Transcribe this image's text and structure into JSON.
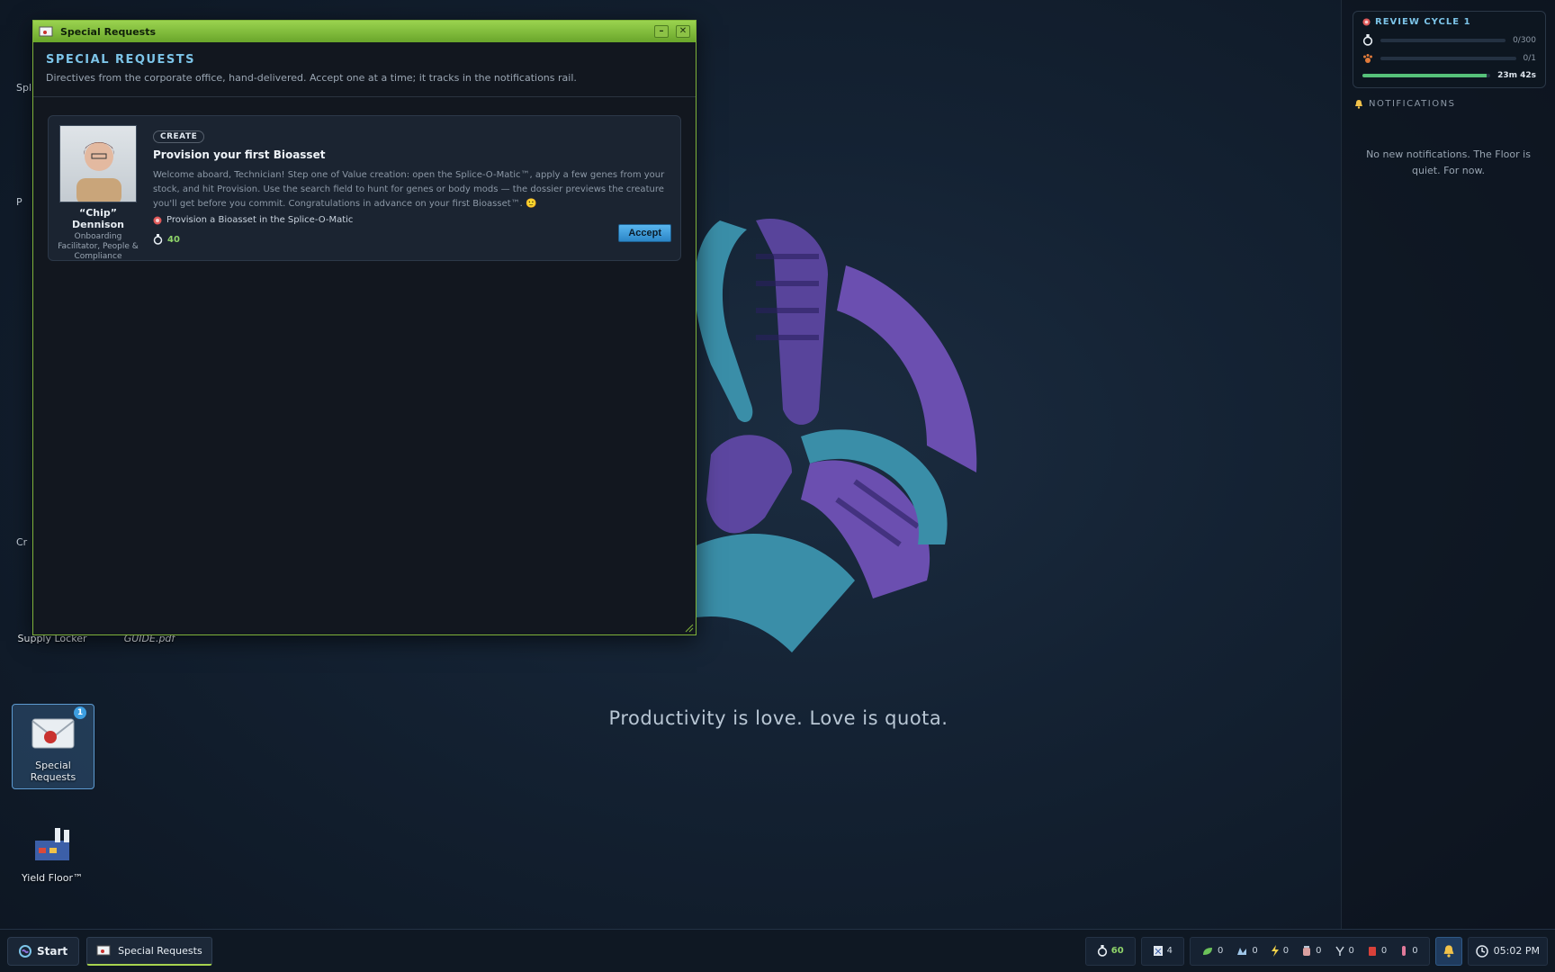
{
  "window": {
    "title": "Special Requests",
    "heading": "SPECIAL REQUESTS",
    "subtitle": "Directives from the corporate office, hand-delivered. Accept one at a time; it tracks in the notifications rail."
  },
  "request_card": {
    "badge": "CREATE",
    "title": "Provision your first Bioasset",
    "description": "Welcome aboard, Technician! Step one of Value creation: open the Splice-O-Matic™, apply a few genes from your stock, and hit Provision. Use the search field to hunt for genes or body mods — the dossier previews the creature you'll get before you commit. Congratulations in advance on your first Bioasset™. 🙂",
    "objective": "Provision a Bioasset in the Splice-O-Matic",
    "reward": "40",
    "accept_label": "Accept",
    "person_name": "“Chip” Dennison",
    "person_role": "Onboarding Facilitator, People & Compliance"
  },
  "desktop": {
    "partial_labels": [
      "Spli",
      "P",
      "Cr"
    ],
    "icons": [
      {
        "label": "Supply Locker"
      },
      {
        "label": "GUIDE.pdf"
      },
      {
        "label": "Special Requests",
        "badge": "1"
      },
      {
        "label": "Yield Floor™"
      }
    ],
    "slogan": "Productivity is love. Love is quota."
  },
  "review_cycle": {
    "title": "REVIEW CYCLE 1",
    "rows": [
      {
        "icon": "flask-icon",
        "value": "0/300",
        "progress": 0
      },
      {
        "icon": "paw-icon",
        "value": "0/1",
        "progress": 0
      }
    ],
    "timer": "23m 42s",
    "timer_progress": 0.97
  },
  "notifications": {
    "heading": "NOTIFICATIONS",
    "empty_text": "No new notifications. The Floor is quiet. For now."
  },
  "taskbar": {
    "start_label": "Start",
    "active_task": "Special Requests",
    "resources": [
      {
        "icon": "flask-icon",
        "value": "60"
      },
      {
        "icon": "document-icon",
        "value": "4"
      },
      {
        "icon": "leaf-icon",
        "value": "0"
      },
      {
        "icon": "crystal-icon",
        "value": "0"
      },
      {
        "icon": "lightning-icon",
        "value": "0"
      },
      {
        "icon": "jar-icon",
        "value": "0"
      },
      {
        "icon": "wrench-icon",
        "value": "0"
      },
      {
        "icon": "fuel-can-icon",
        "value": "0"
      },
      {
        "icon": "vial-icon",
        "value": "0"
      }
    ],
    "clock": "05:02 PM"
  },
  "colors": {
    "accent": "#7cc4e8",
    "titlebar": "#8cc246",
    "teal": "#3a8ea8",
    "purple": "#6b4fb0",
    "reward": "#8fd46a"
  }
}
